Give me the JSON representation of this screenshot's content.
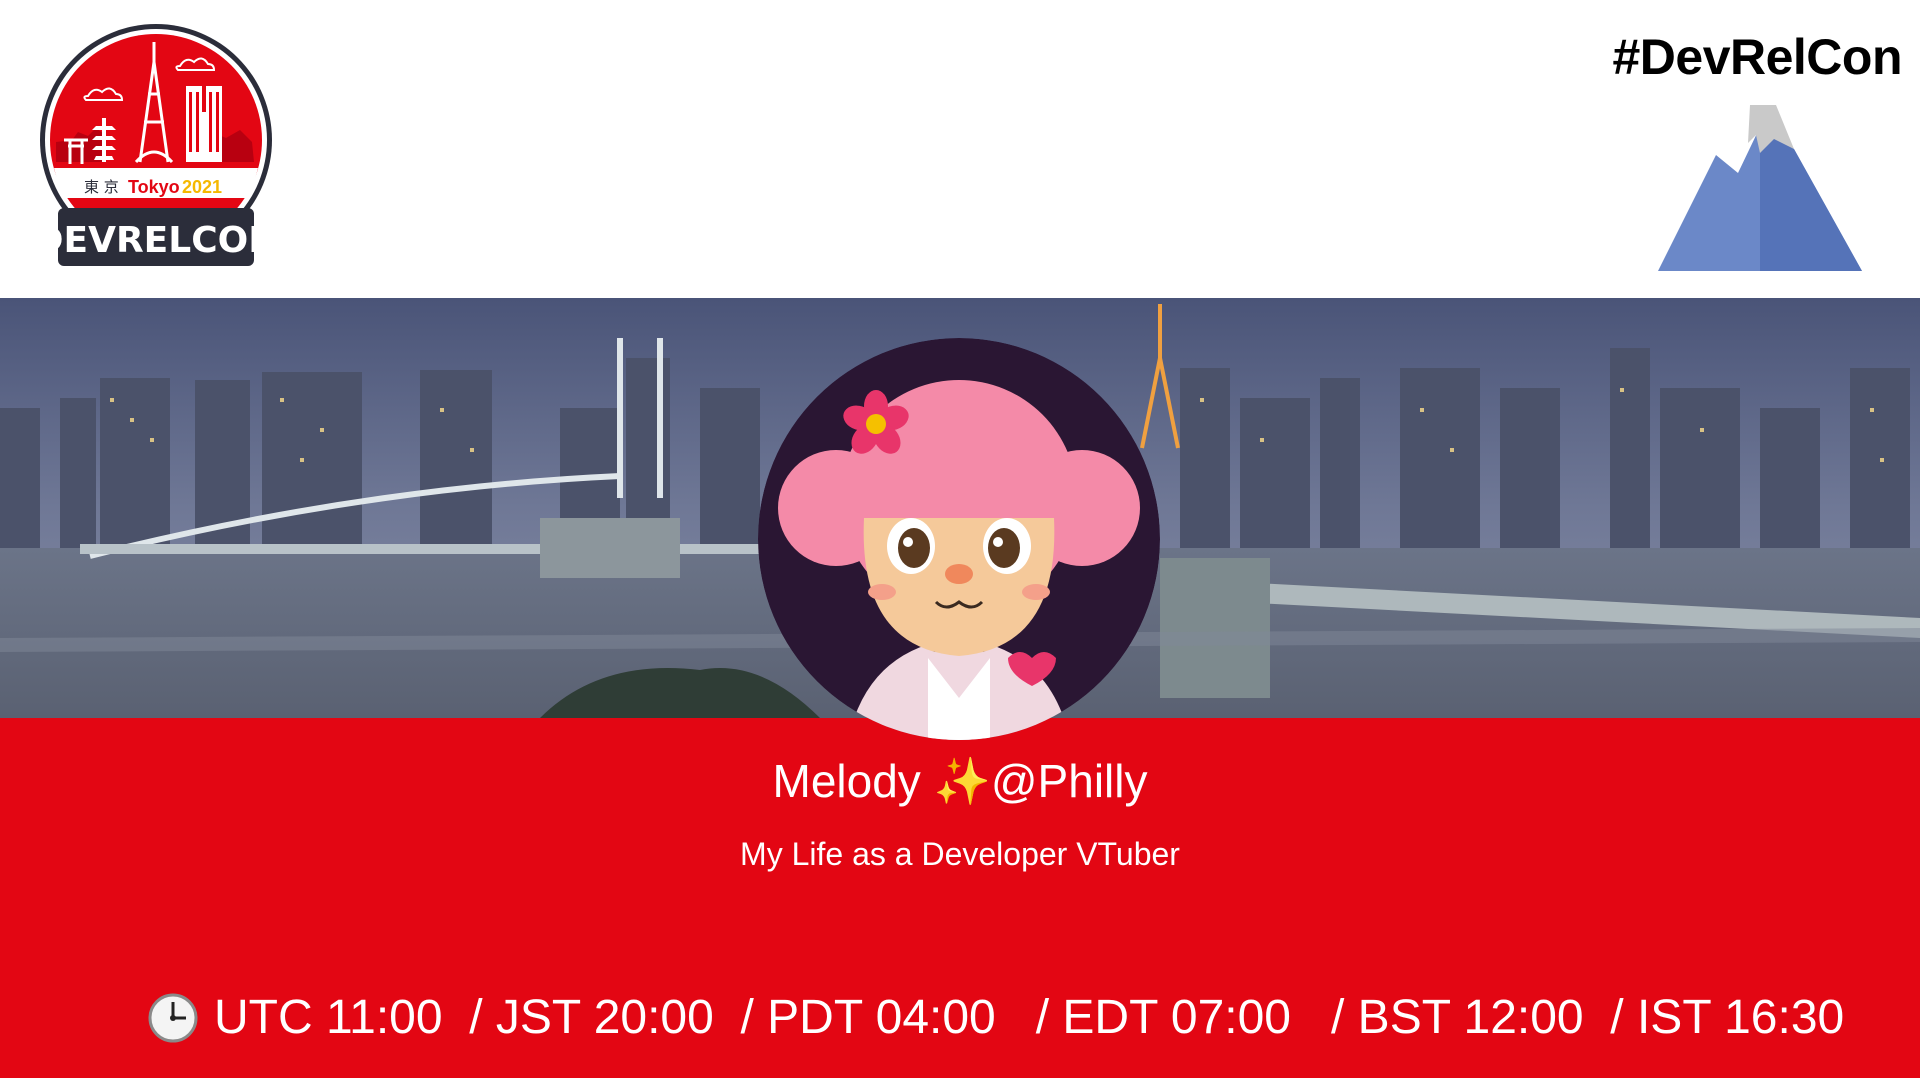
{
  "logo": {
    "kanji": "東 京",
    "city": "Tokyo",
    "year": "2021",
    "brand": "DEVRELCON"
  },
  "hashtag": "#DevRelCon",
  "speaker": {
    "name": "Melody ✨@Philly",
    "talk_title": "My Life as a Developer VTuber"
  },
  "schedule": {
    "icon": "clock-icon",
    "text": "UTC 11:00  / JST 20:00  / PDT 04:00   / EDT 07:00   / BST 12:00  / IST 16:30"
  },
  "colors": {
    "brand_red": "#e30613",
    "mountain_blue": "#5b7cc4",
    "mountain_snow": "#c9c9c9"
  }
}
